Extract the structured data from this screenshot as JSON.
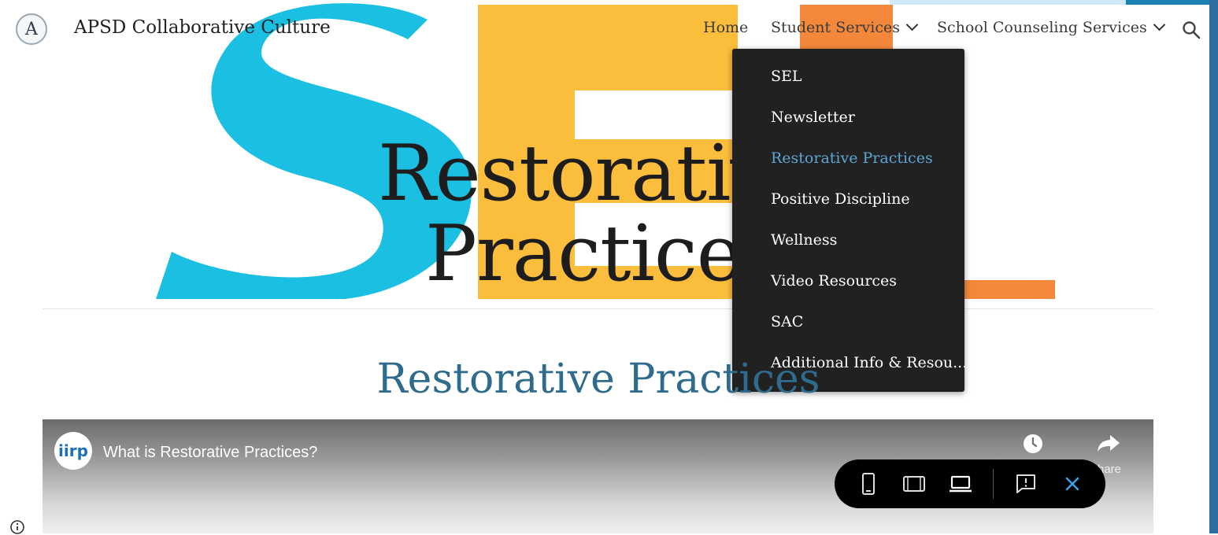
{
  "header": {
    "logo_letter": "A",
    "site_title": "APSD Collaborative Culture",
    "nav": [
      {
        "label": "Home"
      },
      {
        "label": "Student Services"
      },
      {
        "label": "School Counseling Services"
      }
    ]
  },
  "hero": {
    "title_line1": "Restorativ",
    "title_line2": "Practice"
  },
  "dropdown": {
    "items": [
      {
        "label": "SEL"
      },
      {
        "label": "Newsletter"
      },
      {
        "label": "Restorative Practices",
        "active": true
      },
      {
        "label": "Positive Discipline"
      },
      {
        "label": "Wellness"
      },
      {
        "label": "Video Resources"
      },
      {
        "label": "SAC"
      },
      {
        "label": "Additional Info & Resou..."
      }
    ]
  },
  "section": {
    "title": "Restorative Practices"
  },
  "video": {
    "channel_logo": "iirp",
    "title": "What is Restorative Practices?",
    "share_label": "hare"
  },
  "colors": {
    "accent_blue": "#2f6b8c",
    "active_link": "#5aa7d6",
    "banner_cyan": "#1bbfe2",
    "banner_yellow": "#fbbd3c",
    "banner_orange": "#f3883b",
    "dropdown_bg": "#212121"
  },
  "icons": {
    "search": "search-icon",
    "chevron": "chevron-down-icon",
    "clock": "clock-icon",
    "share": "share-icon",
    "info": "info-icon",
    "toolbar": [
      "phone-icon",
      "tablet-icon",
      "laptop-icon",
      "feedback-icon",
      "close-icon"
    ]
  }
}
